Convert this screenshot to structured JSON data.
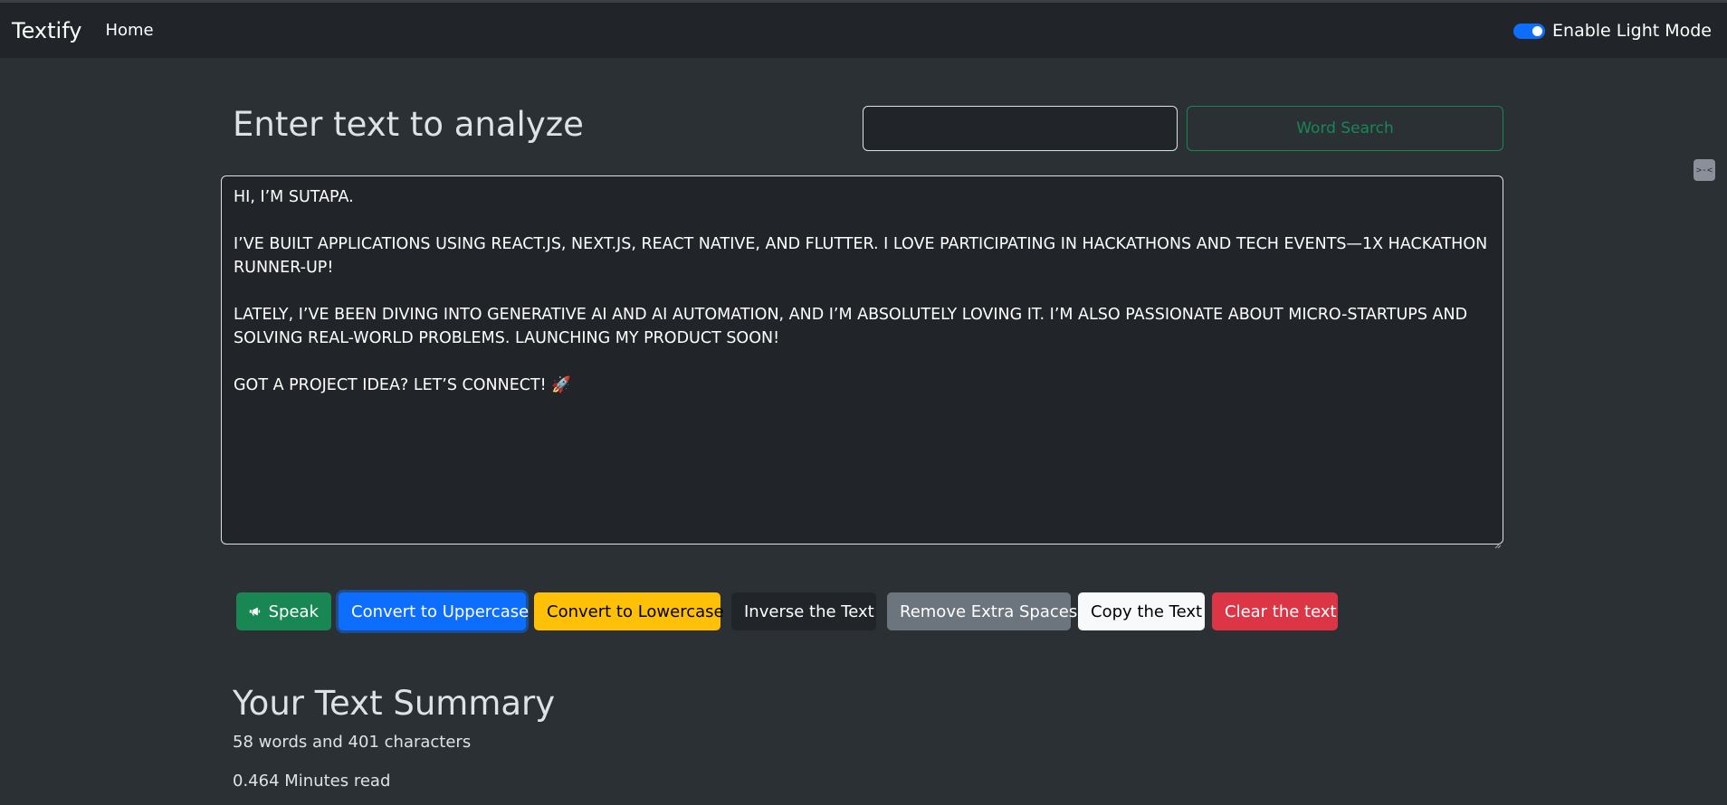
{
  "navbar": {
    "brand": "Textify",
    "home_label": "Home",
    "toggle_label": "Enable Light Mode",
    "toggle_on": true
  },
  "main": {
    "heading": "Enter text to analyze",
    "search": {
      "value": "",
      "placeholder": ""
    },
    "word_search_label": "Word Search",
    "textarea_value": "HI, I’M SUTAPA.\n\nI’VE BUILT APPLICATIONS USING REACT.JS, NEXT.JS, REACT NATIVE, AND FLUTTER. I LOVE PARTICIPATING IN HACKATHONS AND TECH EVENTS—1X HACKATHON RUNNER-UP!\n\nLATELY, I’VE BEEN DIVING INTO GENERATIVE AI AND AI AUTOMATION, AND I’M ABSOLUTELY LOVING IT. I’M ALSO PASSIONATE ABOUT MICRO-STARTUPS AND SOLVING REAL-WORLD PROBLEMS. LAUNCHING MY PRODUCT SOON!\n\nGOT A PROJECT IDEA? LET’S CONNECT! 🚀",
    "side_chip_icon": "terminal-icon",
    "side_chip_glyph": ">-<"
  },
  "buttons": {
    "speak": "Speak",
    "uppercase": "Convert to Uppercase",
    "lowercase": "Convert to Lowercase",
    "inverse": "Inverse the Text",
    "remove_spaces": "Remove Extra Spaces",
    "copy": "Copy the Text",
    "clear": "Clear the text"
  },
  "summary": {
    "title": "Your Text Summary",
    "counts": "58 words and 401 characters",
    "read_time": "0.464 Minutes read"
  },
  "colors": {
    "bg": "#2b3035",
    "navbar": "#212529",
    "success": "#198754",
    "primary": "#0d6efd",
    "warning": "#ffc107",
    "secondary": "#6c757d",
    "danger": "#dc3545",
    "light": "#f8f9fa"
  }
}
